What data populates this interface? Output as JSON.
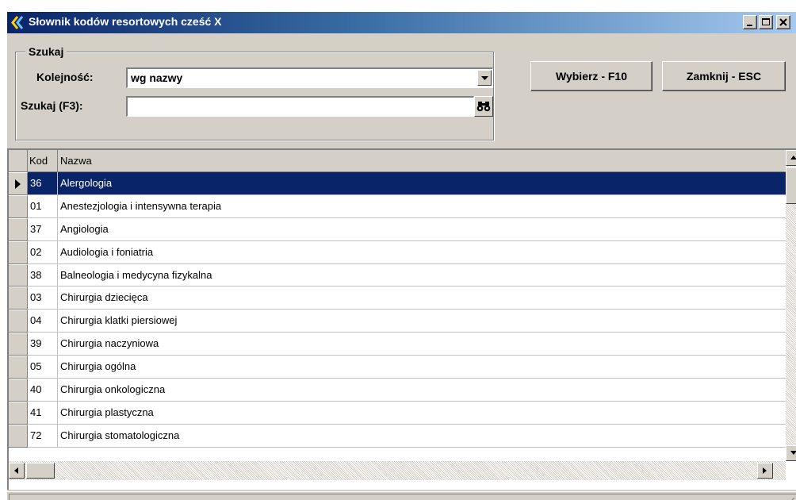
{
  "window": {
    "title": "Słownik kodów resortowych cześć X"
  },
  "search": {
    "group_label": "Szukaj",
    "order_label": "Kolejność:",
    "order_value": "wg nazwy",
    "search_label": "Szukaj (F3):",
    "search_value": ""
  },
  "buttons": {
    "select": "Wybierz - F10",
    "close": "Zamknij - ESC"
  },
  "grid": {
    "columns": [
      "Kod",
      "Nazwa"
    ],
    "selected_index": 0,
    "rows": [
      {
        "kod": "36",
        "nazwa": "Alergologia"
      },
      {
        "kod": "01",
        "nazwa": "Anestezjologia i intensywna terapia"
      },
      {
        "kod": "37",
        "nazwa": "Angiologia"
      },
      {
        "kod": "02",
        "nazwa": "Audiologia i foniatria"
      },
      {
        "kod": "38",
        "nazwa": "Balneologia i medycyna fizykalna"
      },
      {
        "kod": "03",
        "nazwa": "Chirurgia dziecięca"
      },
      {
        "kod": "04",
        "nazwa": "Chirurgia klatki piersiowej"
      },
      {
        "kod": "39",
        "nazwa": "Chirurgia naczyniowa"
      },
      {
        "kod": "05",
        "nazwa": "Chirurgia ogólna"
      },
      {
        "kod": "40",
        "nazwa": "Chirurgia onkologiczna"
      },
      {
        "kod": "41",
        "nazwa": "Chirurgia plastyczna"
      },
      {
        "kod": "72",
        "nazwa": "Chirurgia stomatologiczna"
      }
    ]
  },
  "icons": {
    "app": "app-icon",
    "minimize": "minimize-icon",
    "maximize": "maximize-icon",
    "close": "close-icon",
    "dropdown": "chevron-down-icon",
    "search": "binoculars-icon",
    "row_pointer": "row-pointer-icon"
  },
  "colors": {
    "title_start": "#0a246a",
    "title_end": "#a6caf0",
    "selection": "#0a246a",
    "face": "#d4d0c8"
  }
}
